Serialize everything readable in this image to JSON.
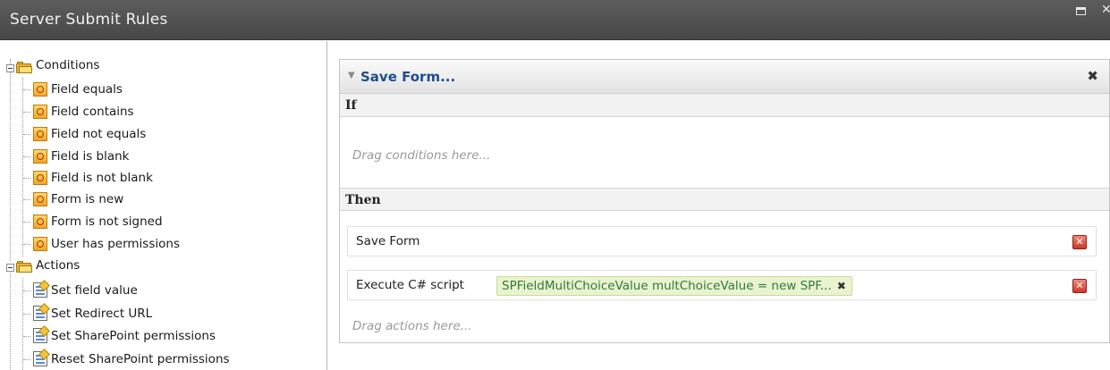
{
  "window": {
    "title": "Server Submit Rules",
    "close_glyph": "✕"
  },
  "tree": {
    "groups": [
      {
        "label": "Conditions",
        "icon": "folder-open-icon",
        "items": [
          {
            "label": "Field equals",
            "icon": "condition-icon"
          },
          {
            "label": "Field contains",
            "icon": "condition-icon"
          },
          {
            "label": "Field not equals",
            "icon": "condition-icon"
          },
          {
            "label": "Field is blank",
            "icon": "condition-icon"
          },
          {
            "label": "Field is not blank",
            "icon": "condition-icon"
          },
          {
            "label": "Form is new",
            "icon": "condition-icon"
          },
          {
            "label": "Form is not signed",
            "icon": "condition-icon"
          },
          {
            "label": "User has permissions",
            "icon": "condition-icon"
          }
        ]
      },
      {
        "label": "Actions",
        "icon": "folder-open-icon",
        "items": [
          {
            "label": "Set field value",
            "icon": "action-icon"
          },
          {
            "label": "Set Redirect URL",
            "icon": "action-icon"
          },
          {
            "label": "Set SharePoint permissions",
            "icon": "action-icon"
          },
          {
            "label": "Reset SharePoint permissions",
            "icon": "action-icon"
          }
        ]
      }
    ]
  },
  "rule": {
    "title": "Save Form...",
    "close_glyph": "✖",
    "if_label": "If",
    "conditions_hint": "Drag conditions here...",
    "then_label": "Then",
    "actions": [
      {
        "text": "Save Form"
      },
      {
        "text": "Execute C# script",
        "chip": "SPFieldMultiChoiceValue multChoiceValue = new SPF...",
        "chip_close": "✖"
      }
    ],
    "actions_hint": "Drag actions here...",
    "delete_glyph": "✕"
  }
}
